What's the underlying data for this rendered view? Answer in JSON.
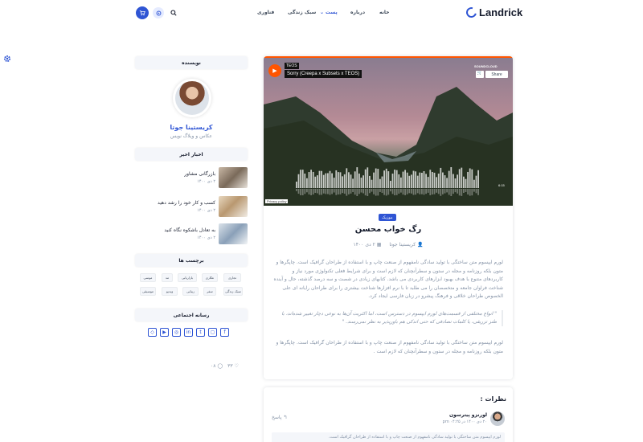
{
  "header": {
    "logo_text": "Landrick",
    "nav": [
      {
        "label": "خانه"
      },
      {
        "label": "درباره"
      },
      {
        "label": "پست"
      },
      {
        "label": "سبک زندگی"
      },
      {
        "label": "فناوری"
      }
    ]
  },
  "sidebar": {
    "author_title": "نویسنده",
    "author_name": "کریستینا جوتا",
    "author_role": "عکاس و ویلاگ نویس",
    "news_title": "اخبار اخیر",
    "posts": [
      {
        "title": "بازرگانی مشاور",
        "date": "۲ دی ۱۴۰۰"
      },
      {
        "title": "کسب و کار خود را رشد دهید",
        "date": "۲ دی ۱۴۰۰"
      },
      {
        "title": "به تعادل باشکوه نگاه کنید",
        "date": "۲ دی ۱۴۰۰"
      }
    ],
    "tags_title": "برچسب ها",
    "tags": [
      "تجاری",
      "عکاری",
      "بازاریابی",
      "مد",
      "موسی",
      "سبک زندگی",
      "سفر",
      "زیبایی",
      "ویدیو",
      "موسیقی"
    ],
    "social_title": "رسانه اجتماعی",
    "socials": [
      "facebook-icon",
      "instagram-icon",
      "twitter-icon",
      "linkedin-icon",
      "github-icon",
      "youtube-icon",
      "gitlab-icon"
    ]
  },
  "player": {
    "artist": "TEOS",
    "track": "Sorry (Creepa x Subsets x TEOS)",
    "brand": "SOUNDCLOUD",
    "share_label": "Share",
    "privacy": "Privacy policy",
    "duration": "6:15"
  },
  "post": {
    "badge": "موزیک",
    "title": "رگ خواب محسن",
    "author": "کریستینا جوتا",
    "date": "۲ دی ۱۴۰۰",
    "paragraph1": "لورم ایپسوم متن ساختگی با تولید سادگی نامفهوم از صنعت چاپ و با استفاده از طراحان گرافیک است. چاپگرها و متون بلکه روزنامه و مجله در ستون و سطرآنچنان که لازم است و برای شرایط فعلی تکنولوژی مورد نیاز و کاربردهای متنوع با هدف بهبود ابزارهای کاربردی می باشد. کتابهای زیادی در شصت و سه درصد گذشته، حال و آینده شناخت فراوان جامعه و متخصصان را می طلبد تا با نرم افزارها شناخت بیشتری را برای طراحان رایانه ای علی الخصوص طراحان خلاقی و فرهنگ پیشرو در زبان فارسی ایجاد کرد.",
    "quote": "\" انواع مختلفی از قسمت‌های لورم ایپسوم در دسترس است، اما اکثریت آن‌ها به نوعی دچار تغییر شده‌اند، با طنز تزریقی، یا کلمات تصادفی که حتی اندکی هم باورپذیر به نظر نمی‌رسند. \"",
    "paragraph2": "لورم ایپسوم متن ساختگی با تولید سادگی نامفهوم از صنعت چاپ و با استفاده از طراحان گرافیک است. چاپگرها و متون بلکه روزنامه و مجله در ستون و سطرآنچنان که لازم است .",
    "likes": "۳۳",
    "comments": "۰۸"
  },
  "comments": {
    "title": "نظرات :",
    "name": "لورنزو پیترسون",
    "time": "۲۰ دی ۱۴۰۰ در ۰۴:۲۵ pm",
    "reply_label": "پاسخ",
    "body": "لورم ایپسوم متن ساختگی با تولید سادگی نامفهوم از صنعت چاپ و با استفاده از طراحان گرافیک است."
  }
}
